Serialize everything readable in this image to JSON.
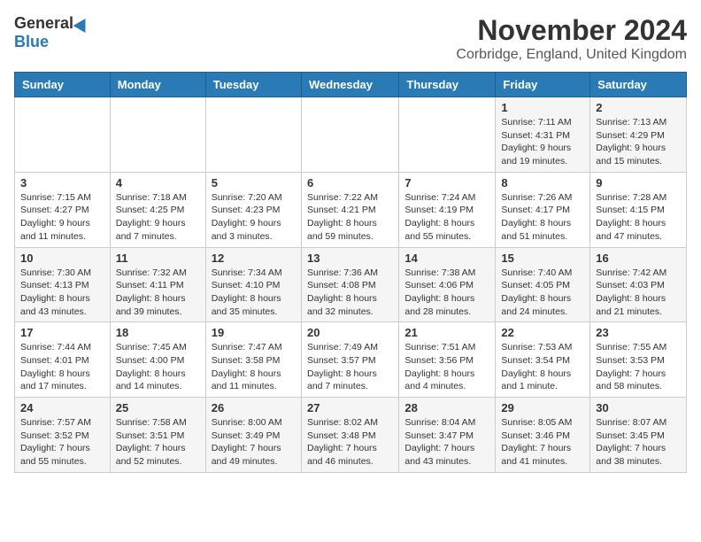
{
  "logo": {
    "general": "General",
    "blue": "Blue"
  },
  "title": "November 2024",
  "location": "Corbridge, England, United Kingdom",
  "days_header": [
    "Sunday",
    "Monday",
    "Tuesday",
    "Wednesday",
    "Thursday",
    "Friday",
    "Saturday"
  ],
  "weeks": [
    [
      {
        "day": "",
        "info": ""
      },
      {
        "day": "",
        "info": ""
      },
      {
        "day": "",
        "info": ""
      },
      {
        "day": "",
        "info": ""
      },
      {
        "day": "",
        "info": ""
      },
      {
        "day": "1",
        "info": "Sunrise: 7:11 AM\nSunset: 4:31 PM\nDaylight: 9 hours and 19 minutes."
      },
      {
        "day": "2",
        "info": "Sunrise: 7:13 AM\nSunset: 4:29 PM\nDaylight: 9 hours and 15 minutes."
      }
    ],
    [
      {
        "day": "3",
        "info": "Sunrise: 7:15 AM\nSunset: 4:27 PM\nDaylight: 9 hours and 11 minutes."
      },
      {
        "day": "4",
        "info": "Sunrise: 7:18 AM\nSunset: 4:25 PM\nDaylight: 9 hours and 7 minutes."
      },
      {
        "day": "5",
        "info": "Sunrise: 7:20 AM\nSunset: 4:23 PM\nDaylight: 9 hours and 3 minutes."
      },
      {
        "day": "6",
        "info": "Sunrise: 7:22 AM\nSunset: 4:21 PM\nDaylight: 8 hours and 59 minutes."
      },
      {
        "day": "7",
        "info": "Sunrise: 7:24 AM\nSunset: 4:19 PM\nDaylight: 8 hours and 55 minutes."
      },
      {
        "day": "8",
        "info": "Sunrise: 7:26 AM\nSunset: 4:17 PM\nDaylight: 8 hours and 51 minutes."
      },
      {
        "day": "9",
        "info": "Sunrise: 7:28 AM\nSunset: 4:15 PM\nDaylight: 8 hours and 47 minutes."
      }
    ],
    [
      {
        "day": "10",
        "info": "Sunrise: 7:30 AM\nSunset: 4:13 PM\nDaylight: 8 hours and 43 minutes."
      },
      {
        "day": "11",
        "info": "Sunrise: 7:32 AM\nSunset: 4:11 PM\nDaylight: 8 hours and 39 minutes."
      },
      {
        "day": "12",
        "info": "Sunrise: 7:34 AM\nSunset: 4:10 PM\nDaylight: 8 hours and 35 minutes."
      },
      {
        "day": "13",
        "info": "Sunrise: 7:36 AM\nSunset: 4:08 PM\nDaylight: 8 hours and 32 minutes."
      },
      {
        "day": "14",
        "info": "Sunrise: 7:38 AM\nSunset: 4:06 PM\nDaylight: 8 hours and 28 minutes."
      },
      {
        "day": "15",
        "info": "Sunrise: 7:40 AM\nSunset: 4:05 PM\nDaylight: 8 hours and 24 minutes."
      },
      {
        "day": "16",
        "info": "Sunrise: 7:42 AM\nSunset: 4:03 PM\nDaylight: 8 hours and 21 minutes."
      }
    ],
    [
      {
        "day": "17",
        "info": "Sunrise: 7:44 AM\nSunset: 4:01 PM\nDaylight: 8 hours and 17 minutes."
      },
      {
        "day": "18",
        "info": "Sunrise: 7:45 AM\nSunset: 4:00 PM\nDaylight: 8 hours and 14 minutes."
      },
      {
        "day": "19",
        "info": "Sunrise: 7:47 AM\nSunset: 3:58 PM\nDaylight: 8 hours and 11 minutes."
      },
      {
        "day": "20",
        "info": "Sunrise: 7:49 AM\nSunset: 3:57 PM\nDaylight: 8 hours and 7 minutes."
      },
      {
        "day": "21",
        "info": "Sunrise: 7:51 AM\nSunset: 3:56 PM\nDaylight: 8 hours and 4 minutes."
      },
      {
        "day": "22",
        "info": "Sunrise: 7:53 AM\nSunset: 3:54 PM\nDaylight: 8 hours and 1 minute."
      },
      {
        "day": "23",
        "info": "Sunrise: 7:55 AM\nSunset: 3:53 PM\nDaylight: 7 hours and 58 minutes."
      }
    ],
    [
      {
        "day": "24",
        "info": "Sunrise: 7:57 AM\nSunset: 3:52 PM\nDaylight: 7 hours and 55 minutes."
      },
      {
        "day": "25",
        "info": "Sunrise: 7:58 AM\nSunset: 3:51 PM\nDaylight: 7 hours and 52 minutes."
      },
      {
        "day": "26",
        "info": "Sunrise: 8:00 AM\nSunset: 3:49 PM\nDaylight: 7 hours and 49 minutes."
      },
      {
        "day": "27",
        "info": "Sunrise: 8:02 AM\nSunset: 3:48 PM\nDaylight: 7 hours and 46 minutes."
      },
      {
        "day": "28",
        "info": "Sunrise: 8:04 AM\nSunset: 3:47 PM\nDaylight: 7 hours and 43 minutes."
      },
      {
        "day": "29",
        "info": "Sunrise: 8:05 AM\nSunset: 3:46 PM\nDaylight: 7 hours and 41 minutes."
      },
      {
        "day": "30",
        "info": "Sunrise: 8:07 AM\nSunset: 3:45 PM\nDaylight: 7 hours and 38 minutes."
      }
    ]
  ]
}
